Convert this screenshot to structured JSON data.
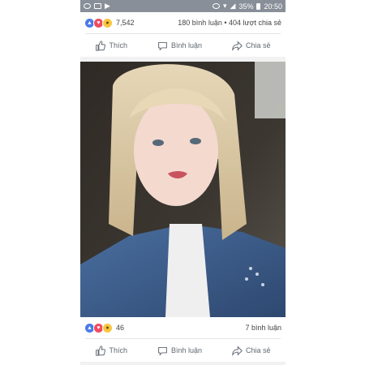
{
  "status_bar": {
    "battery": "35%",
    "time": "20:50"
  },
  "post_top": {
    "reaction_count": "7,542",
    "comments": "180 bình luận",
    "separator": "•",
    "shares": "404 lượt chia sẻ"
  },
  "actions": {
    "like": "Thích",
    "comment": "Bình luận",
    "share": "Chia sẻ"
  },
  "post_bottom": {
    "reaction_count": "46",
    "comments": "7 bình luận"
  },
  "colors": {
    "status_bar": "#888f98",
    "like": "#4a7be8",
    "love": "#ef4b5f",
    "wow": "#f7c53f",
    "action_text": "#606770"
  }
}
